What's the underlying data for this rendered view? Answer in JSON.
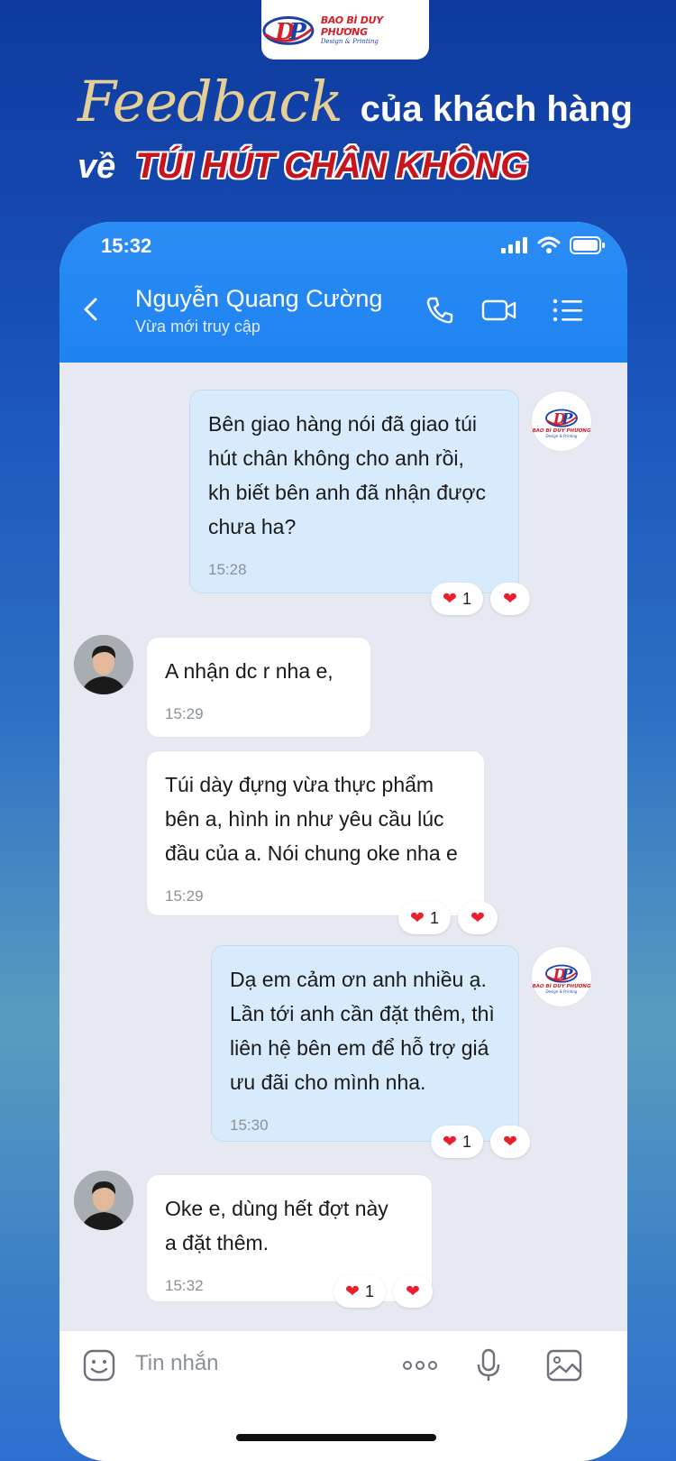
{
  "brand": {
    "name": "BAO BÌ DUY PHƯƠNG",
    "tagline": "Design & Printing",
    "initials": "DP"
  },
  "headline": {
    "script_word": "Feedback",
    "line1_rest": "của khách hàng",
    "line2_prefix": "về",
    "product": "TÚI HÚT CHÂN KHÔNG"
  },
  "status_bar": {
    "time": "15:32"
  },
  "header": {
    "contact_name": "Nguyễn Quang Cường",
    "contact_status": "Vừa mới truy cập",
    "icons": [
      "back-icon",
      "phone-icon",
      "video-icon",
      "menu-icon"
    ]
  },
  "messages": [
    {
      "side": "out",
      "text": "Bên giao hàng nói đã giao túi\nhút chân không cho anh rồi,\nkh biết bên anh đã nhận được\nchưa ha?",
      "time": "15:28",
      "reaction_count": "1"
    },
    {
      "side": "in",
      "text": "A nhận dc r nha e,",
      "time": "15:29",
      "reaction_count": ""
    },
    {
      "side": "in",
      "text": "Túi dày đựng vừa thực phẩm\nbên a, hình in như yêu cầu lúc\nđầu của a. Nói chung oke nha e",
      "time": "15:29",
      "reaction_count": "1"
    },
    {
      "side": "out",
      "text": "Dạ em cảm ơn anh nhiều ạ.\nLần tới anh cần đặt thêm, thì\nliên hệ bên em để hỗ trợ giá\nưu đãi cho mình nha.",
      "time": "15:30",
      "reaction_count": "1"
    },
    {
      "side": "in",
      "text": "Oke e, dùng hết đợt này\na đặt thêm.",
      "time": "15:32",
      "reaction_count": "1"
    }
  ],
  "composer": {
    "placeholder": "Tin nhắn",
    "icons": [
      "sticker-icon",
      "more-icon",
      "microphone-icon",
      "image-icon"
    ]
  },
  "colors": {
    "header_blue": "#2b8cf5",
    "out_bubble": "#d7ebfc",
    "heart": "#e8202e",
    "brand_red": "#d3202a",
    "brand_blue": "#1c3fa8"
  }
}
